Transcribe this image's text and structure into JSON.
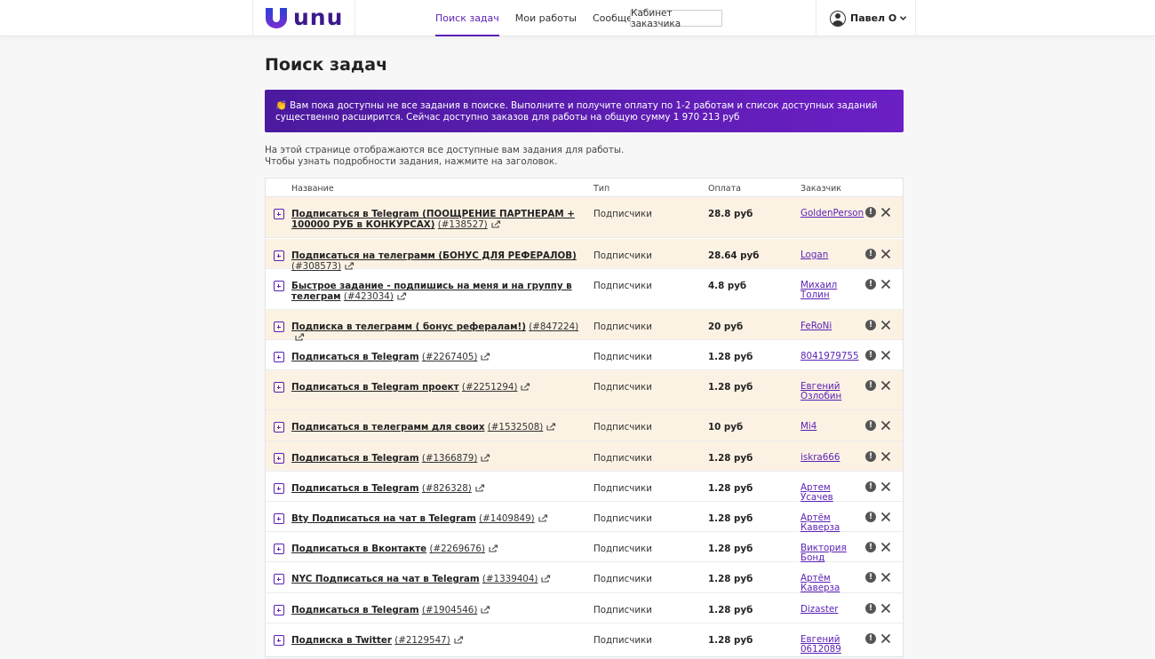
{
  "header": {
    "logo_text": "unu",
    "nav": [
      "Поиск задач",
      "Мои работы",
      "Сообщения"
    ],
    "client_button": "Кабинет заказчика",
    "user_name": "Павел О"
  },
  "page": {
    "title": "Поиск задач",
    "banner": "👏 Вам пока доступны не все задания в поиске. Выполните и получите оплату по 1-2 работам и список доступных заданий существенно расширится. Сейчас доступно заказов для работы на общую сумму 1 970 213 руб",
    "intro_line1": "На этой странице отображаются все доступные вам задания для работы.",
    "intro_line2": "Чтобы узнать подробности задания, нажмите на заголовок."
  },
  "table": {
    "headers": {
      "name": "Название",
      "type": "Тип",
      "pay": "Оплата",
      "customer": "Заказчик"
    },
    "rows": [
      {
        "title": "Подписаться в Telegram (ПООЩРЕНИЕ ПАРТНЕРАМ + 100000 РУБ в КОНКУРСАХ)",
        "id": "(#138527)",
        "type": "Подписчики",
        "pay": "28.8 руб",
        "customer": "GoldenPerson"
      },
      {
        "title": "Подписаться на телеграмм (БОНУС ДЛЯ РЕФЕРАЛОВ)",
        "id": "(#308573)",
        "type": "Подписчики",
        "pay": "28.64 руб",
        "customer": "Logan"
      },
      {
        "title": "Быстрое задание - подпишись на меня и на группу в телеграм",
        "id": "(#423034)",
        "type": "Подписчики",
        "pay": "4.8 руб",
        "customer": "Михаил Толин"
      },
      {
        "title": "Подписка в телеграмм ( бонус рефералам!)",
        "id": "(#847224)",
        "type": "Подписчики",
        "pay": "20 руб",
        "customer": "FeRoNi"
      },
      {
        "title": "Подписаться в Telegram",
        "id": "(#2267405)",
        "type": "Подписчики",
        "pay": "1.28 руб",
        "customer": "8041979755"
      },
      {
        "title": "Подписаться в Telegram проект",
        "id": "(#2251294)",
        "type": "Подписчики",
        "pay": "1.28 руб",
        "customer": "Евгений Озлобин"
      },
      {
        "title": "Подписаться в телеграмм для своих",
        "id": "(#1532508)",
        "type": "Подписчики",
        "pay": "10 руб",
        "customer": "Mi4"
      },
      {
        "title": "Подписаться в Telegram",
        "id": "(#1366879)",
        "type": "Подписчики",
        "pay": "1.28 руб",
        "customer": "iskra666"
      },
      {
        "title": "Подписаться в Telegram",
        "id": "(#826328)",
        "type": "Подписчики",
        "pay": "1.28 руб",
        "customer": "Артем Усачев"
      },
      {
        "title": "Bty Подписаться на чат в Telegram",
        "id": "(#1409849)",
        "type": "Подписчики",
        "pay": "1.28 руб",
        "customer": "Артём Каверза"
      },
      {
        "title": "Подписаться в Вконтакте",
        "id": "(#2269676)",
        "type": "Подписчики",
        "pay": "1.28 руб",
        "customer": "Виктория Бонд"
      },
      {
        "title": "NYC Подписаться на чат в Telegram",
        "id": "(#1339404)",
        "type": "Подписчики",
        "pay": "1.28 руб",
        "customer": "Артём Каверза"
      },
      {
        "title": "Подписаться в Telegram",
        "id": "(#1904546)",
        "type": "Подписчики",
        "pay": "1.28 руб",
        "customer": "Dizaster"
      },
      {
        "title": "Подписка в Twitter",
        "id": "(#2129547)",
        "type": "Подписчики",
        "pay": "1.28 руб",
        "customer": "Евгений 0612089"
      }
    ]
  }
}
